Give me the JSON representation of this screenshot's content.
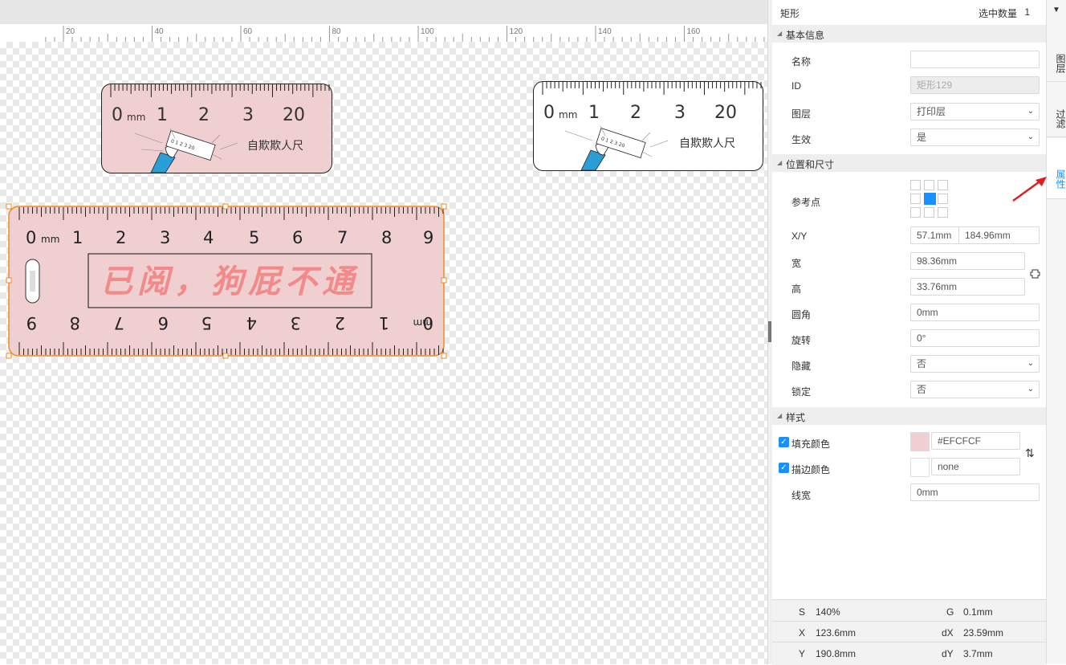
{
  "ruler": {
    "labels": [
      "20",
      "40",
      "60",
      "80",
      "100",
      "120",
      "140",
      "160"
    ]
  },
  "canvas": {
    "ruler_small": {
      "top_numbers": [
        "0",
        "1",
        "2",
        "3",
        "20"
      ],
      "unit": "mm",
      "caption": "自欺欺人尺",
      "mini_numbers": "0 1 2 3 20"
    },
    "ruler_large": {
      "top_numbers": [
        "0",
        "1",
        "2",
        "3",
        "4",
        "5",
        "6",
        "7",
        "8",
        "9"
      ],
      "unit": "mm",
      "bottom_numbers": [
        "9",
        "8",
        "7",
        "6",
        "5",
        "4",
        "3",
        "2",
        "1",
        "0"
      ],
      "calligraphy": "已阅，狗屁不通"
    }
  },
  "panel": {
    "title": "矩形",
    "selected_label": "选中数量",
    "selected_count": "1",
    "sections": {
      "basic": "基本信息",
      "position": "位置和尺寸",
      "style": "样式"
    },
    "fields": {
      "name_label": "名称",
      "name_value": "",
      "id_label": "ID",
      "id_value": "矩形129",
      "layer_label": "图层",
      "layer_value": "打印层",
      "effective_label": "生效",
      "effective_value": "是",
      "ref_label": "参考点",
      "xy_label": "X/Y",
      "x_value": "57.1mm",
      "y_value": "184.96mm",
      "width_label": "宽",
      "width_value": "98.36mm",
      "height_label": "高",
      "height_value": "33.76mm",
      "radius_label": "圆角",
      "radius_value": "0mm",
      "rotate_label": "旋转",
      "rotate_value": "0°",
      "hidden_label": "隐藏",
      "hidden_value": "否",
      "lock_label": "锁定",
      "lock_value": "否",
      "fill_label": "填充颜色",
      "fill_value": "#EFCFCF",
      "stroke_label": "描边颜色",
      "stroke_value": "none",
      "linewidth_label": "线宽",
      "linewidth_value": "0mm"
    },
    "colors": {
      "fill": "#EFCFCF",
      "accent": "#1890ff"
    }
  },
  "status": {
    "s_key": "S",
    "s_val": "140%",
    "g_key": "G",
    "g_val": "0.1mm",
    "x_key": "X",
    "x_val": "123.6mm",
    "dx_key": "dX",
    "dx_val": "23.59mm",
    "y_key": "Y",
    "y_val": "190.8mm",
    "dy_key": "dY",
    "dy_val": "3.7mm"
  },
  "right_tabs": {
    "layers": "图层",
    "filter": "过滤",
    "properties": "属性",
    "active": "properties"
  }
}
